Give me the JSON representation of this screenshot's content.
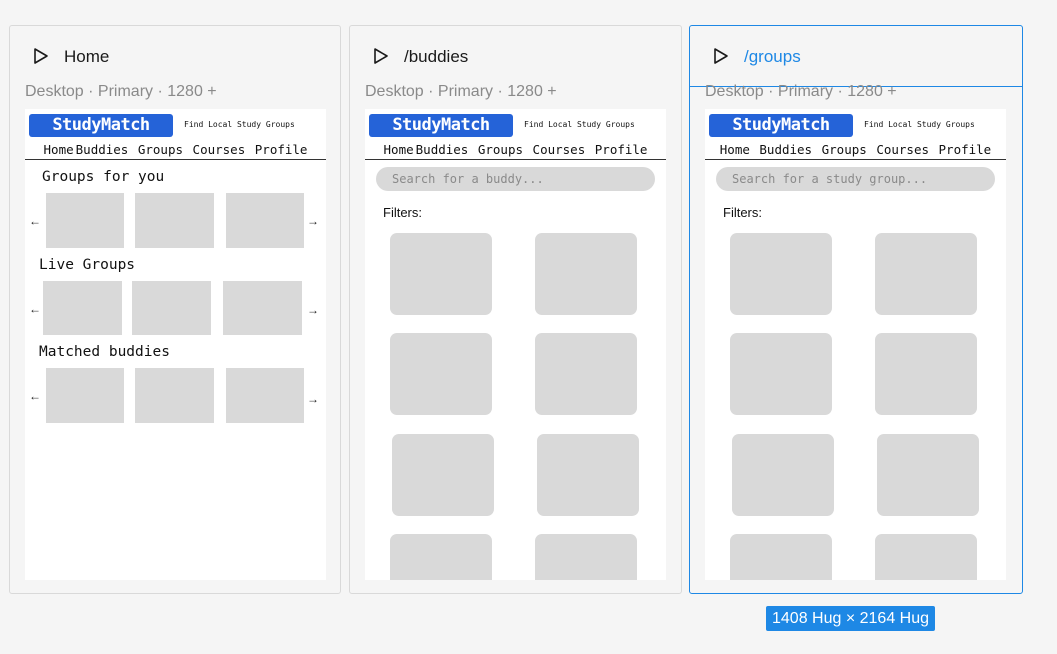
{
  "frames": [
    {
      "title": "Home",
      "device_label": "Desktop · Primary · 1280 +",
      "logo": "StudyMatch",
      "tagline": "Find Local Study Groups",
      "nav": [
        "Home",
        "Buddies",
        "Groups",
        "Courses",
        "Profile"
      ],
      "sections": [
        {
          "title": "Groups for you"
        },
        {
          "title": "Live Groups"
        },
        {
          "title": "Matched buddies"
        }
      ],
      "arrow_left": "←",
      "arrow_right": "→"
    },
    {
      "title": "/buddies",
      "device_label": "Desktop · Primary · 1280 +",
      "logo": "StudyMatch",
      "tagline": "Find Local Study Groups",
      "nav": [
        "Home",
        "Buddies",
        "Groups",
        "Courses",
        "Profile"
      ],
      "search_placeholder": "Search for a buddy...",
      "filters_label": "Filters:"
    },
    {
      "title": "/groups",
      "device_label": "Desktop · Primary · 1280 +",
      "logo": "StudyMatch",
      "tagline": "Find Local Study Groups",
      "nav": [
        "Home",
        "Buddies",
        "Groups",
        "Courses",
        "Profile"
      ],
      "search_placeholder": "Search for a study group...",
      "filters_label": "Filters:"
    }
  ],
  "selection": {
    "size_label": "1408 Hug × 2164 Hug",
    "color": "#1e88e5"
  },
  "colors": {
    "logo_bg": "#2563d8",
    "placeholder": "#d9d9d9"
  }
}
